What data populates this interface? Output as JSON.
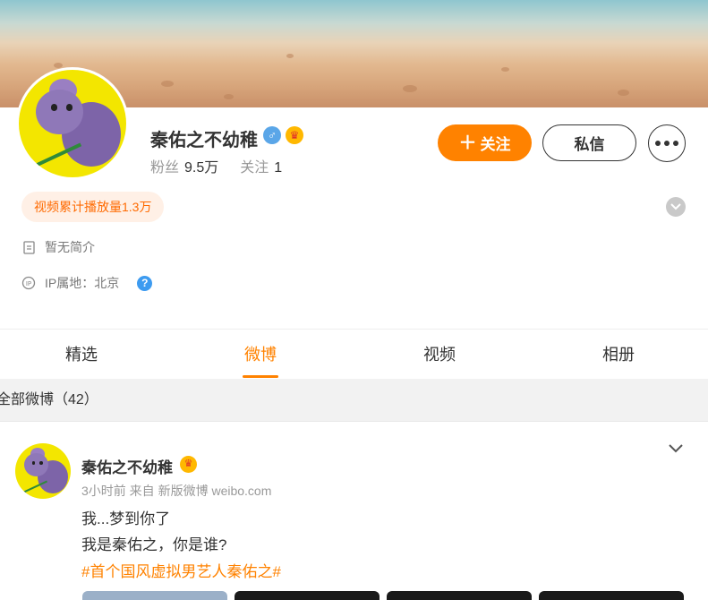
{
  "profile": {
    "name": "秦佑之不幼稚",
    "gender_icon": "male-icon",
    "vip_icon": "vip-crown-icon",
    "fans_label": "粉丝",
    "fans_count": "9.5万",
    "following_label": "关注",
    "following_count": "1",
    "follow_button": "关注",
    "message_button": "私信",
    "views_badge": "视频累计播放量1.3万",
    "bio": "暂无简介",
    "ip_location": "IP属地：北京"
  },
  "tabs": [
    {
      "label": "精选",
      "active": false
    },
    {
      "label": "微博",
      "active": true
    },
    {
      "label": "视频",
      "active": false
    },
    {
      "label": "相册",
      "active": false
    }
  ],
  "filter": {
    "label": "全部微博（42）"
  },
  "post": {
    "author": "秦佑之不幼稚",
    "meta": "3小时前 来自 新版微博 weibo.com",
    "lines": [
      "我...梦到你了",
      "我是秦佑之，你是谁?"
    ],
    "tag": "#首个国风虚拟男艺人秦佑之#"
  },
  "colors": {
    "accent": "#ff8200",
    "link": "#ff8200",
    "badge_bg": "#fff0e6"
  }
}
